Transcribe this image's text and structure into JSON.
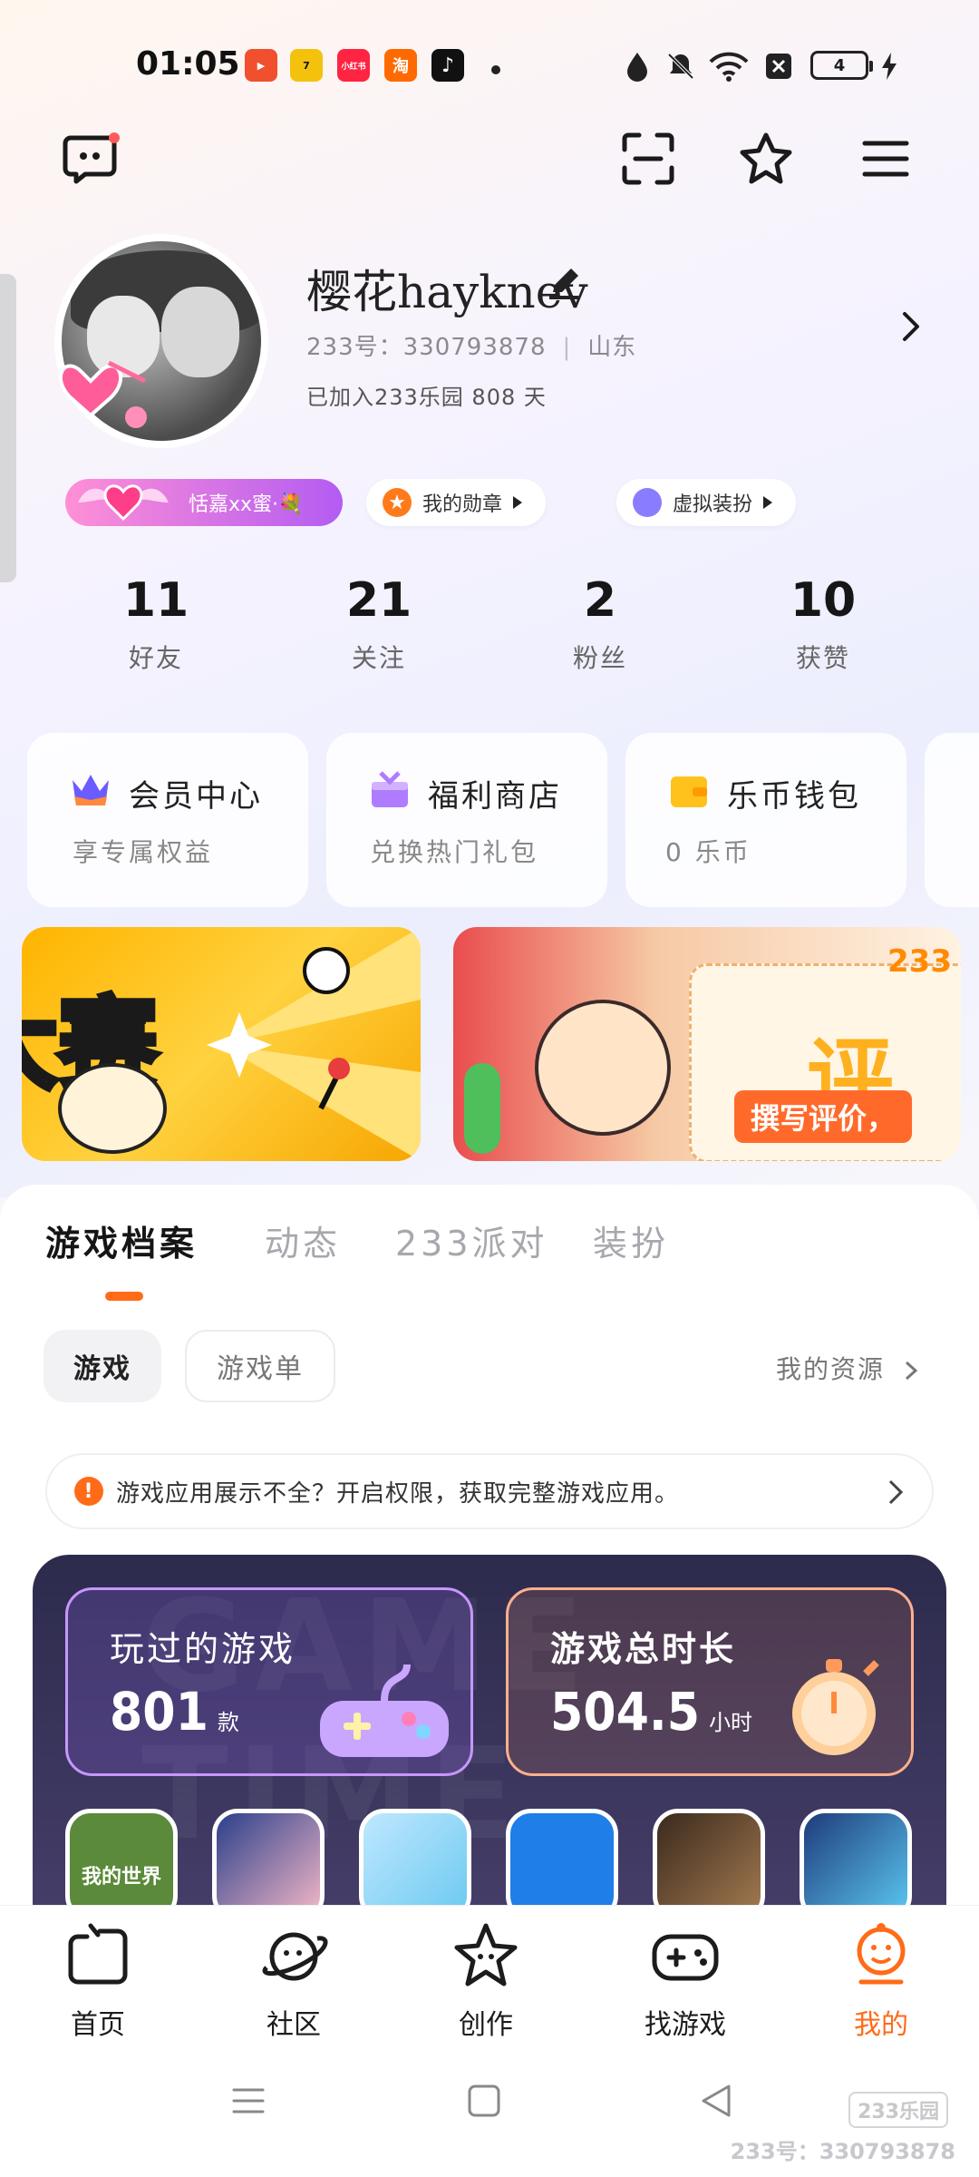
{
  "status_bar": {
    "time": "01:05",
    "battery": "4",
    "apps": [
      {
        "name": "video-app",
        "color": "#f0502e",
        "text": "▶"
      },
      {
        "name": "qimao-app",
        "color": "#f4c20d",
        "text": "7"
      },
      {
        "name": "xiaohongshu-app",
        "color": "#ff2442",
        "text": "小红书"
      },
      {
        "name": "taobao-app",
        "color": "#ff6a00",
        "text": "淘"
      },
      {
        "name": "tiktok-app",
        "color": "#111111",
        "text": "♪"
      }
    ]
  },
  "profile": {
    "username": "樱花hayknev",
    "id_label": "233号：330793878",
    "region": "山东",
    "join_text": "已加入233乐园 808 天",
    "vip_tag": "恬嘉xx蜜·💐",
    "badges": [
      {
        "label": "我的勋章",
        "color": "#ff7a1a"
      },
      {
        "label": "虚拟装扮",
        "color": "#8a7cff"
      }
    ]
  },
  "stats": [
    {
      "value": "11",
      "label": "好友"
    },
    {
      "value": "21",
      "label": "关注"
    },
    {
      "value": "2",
      "label": "粉丝"
    },
    {
      "value": "10",
      "label": "获赞"
    }
  ],
  "feature_cards": [
    {
      "title": "会员中心",
      "subtitle": "享专属权益"
    },
    {
      "title": "福利商店",
      "subtitle": "兑换热门礼包"
    },
    {
      "title": "乐币钱包",
      "subtitle": "0 乐币"
    }
  ],
  "banners": {
    "left_text": "大赛",
    "right_text": "评测",
    "right_tag": "撰写评价，",
    "right_corner": "233"
  },
  "tabs": [
    "游戏档案",
    "动态",
    "233派对",
    "装扮"
  ],
  "chips": {
    "games": "游戏",
    "game_list": "游戏单",
    "resources": "我的资源"
  },
  "notice": "游戏应用展示不全？开启权限，获取完整游戏应用。",
  "game_panel": {
    "watermark": "GAME TIME",
    "played_title": "玩过的游戏",
    "played_value": "801",
    "played_unit": "款",
    "time_title": "游戏总时长",
    "time_value": "504.5",
    "time_unit": "小时",
    "games": [
      {
        "name": "minecraft",
        "label": "我的世界",
        "color": "#5a8a3a"
      },
      {
        "name": "sakura-school",
        "label": "",
        "color": "#f5b8c8"
      },
      {
        "name": "toca-world",
        "label": "",
        "color": "#6cc9f0"
      },
      {
        "name": "builder-game",
        "label": "",
        "color": "#1f7ee8"
      },
      {
        "name": "pubg",
        "label": "",
        "color": "#6b4a2e"
      },
      {
        "name": "toca-life",
        "label": "",
        "color": "#1e3b7a"
      }
    ]
  },
  "bottom_nav": [
    {
      "label": "首页",
      "active": false
    },
    {
      "label": "社区",
      "active": false
    },
    {
      "label": "创作",
      "active": false
    },
    {
      "label": "找游戏",
      "active": false
    },
    {
      "label": "我的",
      "active": true
    }
  ],
  "watermark": {
    "logo": "233乐园",
    "id": "233号：330793878"
  },
  "colors": {
    "accent": "#ff6b18",
    "panel_dark": "#2c2b4c"
  }
}
